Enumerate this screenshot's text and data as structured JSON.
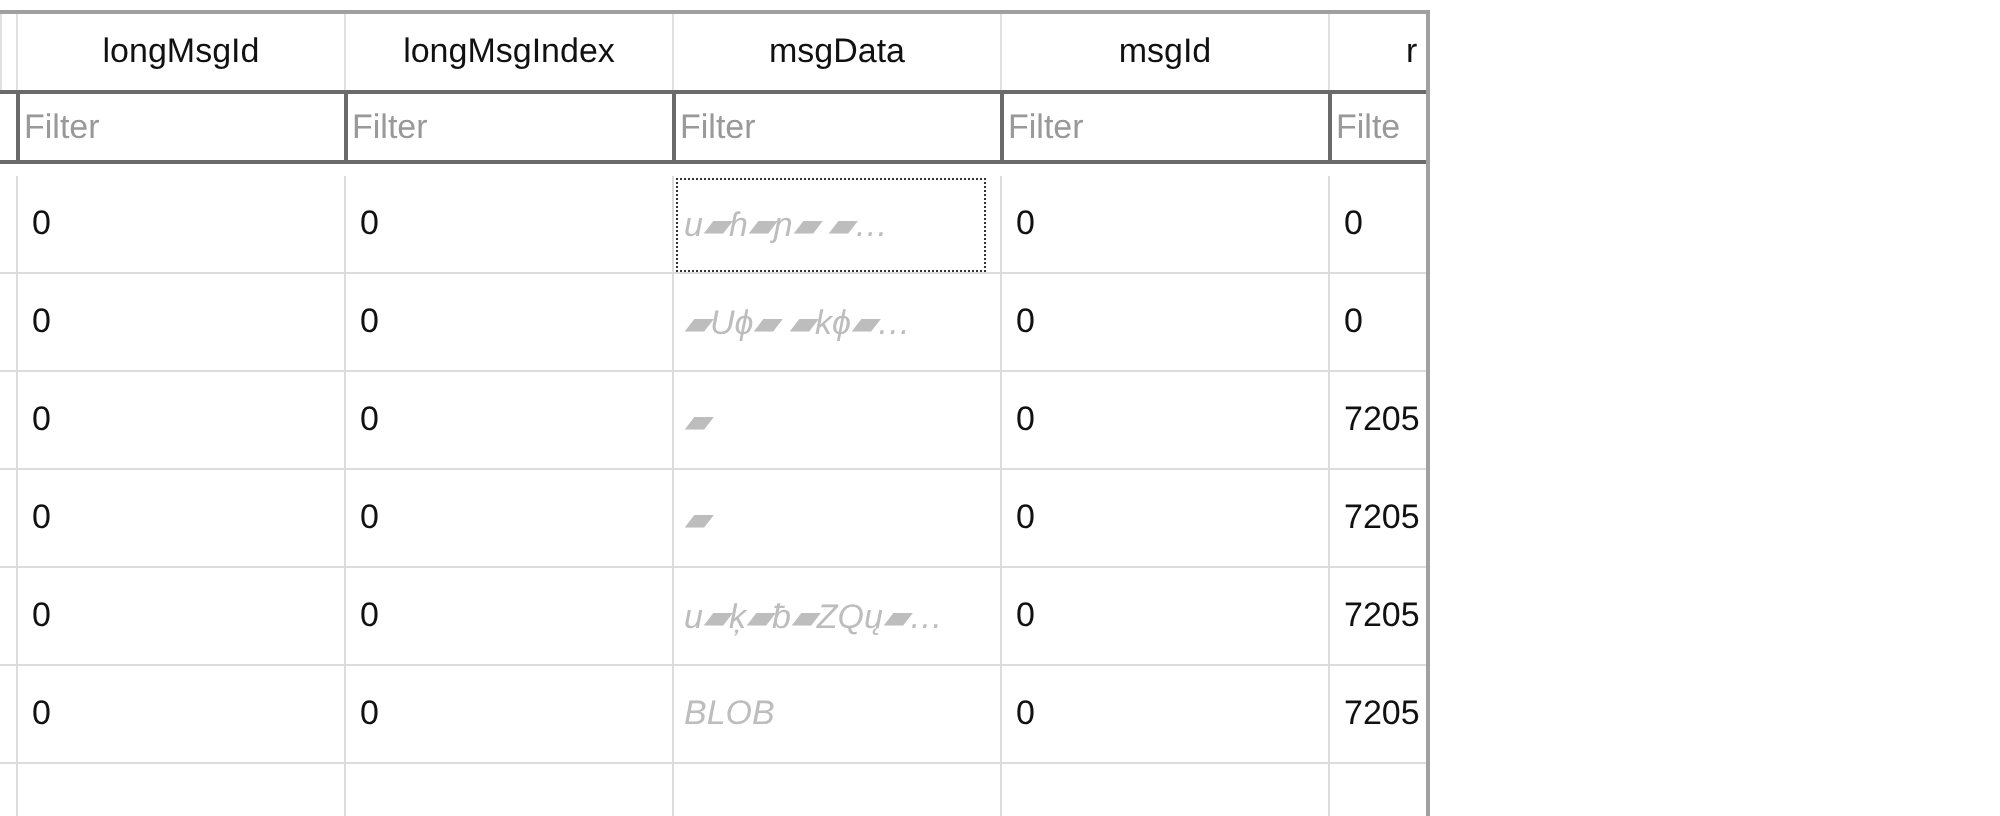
{
  "table": {
    "columns": [
      {
        "label": "longMsgId",
        "filter_placeholder": "Filter"
      },
      {
        "label": "longMsgIndex",
        "filter_placeholder": "Filter"
      },
      {
        "label": "msgData",
        "filter_placeholder": "Filter"
      },
      {
        "label": "msgId",
        "filter_placeholder": "Filter"
      },
      {
        "label": "r",
        "filter_placeholder": "Filte"
      }
    ],
    "rows": [
      {
        "focused_cell": true,
        "cells": [
          "0",
          "0",
          "u▰ɦ▰ɲ▰  ▰…",
          "0",
          "0"
        ]
      },
      {
        "focused_cell": false,
        "cells": [
          "0",
          "0",
          "▰Uϕ▰ ▰kϕ▰…",
          "0",
          "0"
        ]
      },
      {
        "focused_cell": false,
        "cells": [
          "0",
          "0",
          "▰",
          "0",
          "7205"
        ]
      },
      {
        "focused_cell": false,
        "cells": [
          "0",
          "0",
          "▰",
          "0",
          "7205"
        ]
      },
      {
        "focused_cell": false,
        "cells": [
          "0",
          "0",
          "u▰ķ▰ƀ▰ZQų▰…",
          "0",
          "7205"
        ]
      },
      {
        "focused_cell": false,
        "cells": [
          "0",
          "0",
          "BLOB",
          "0",
          "7205"
        ]
      }
    ]
  }
}
